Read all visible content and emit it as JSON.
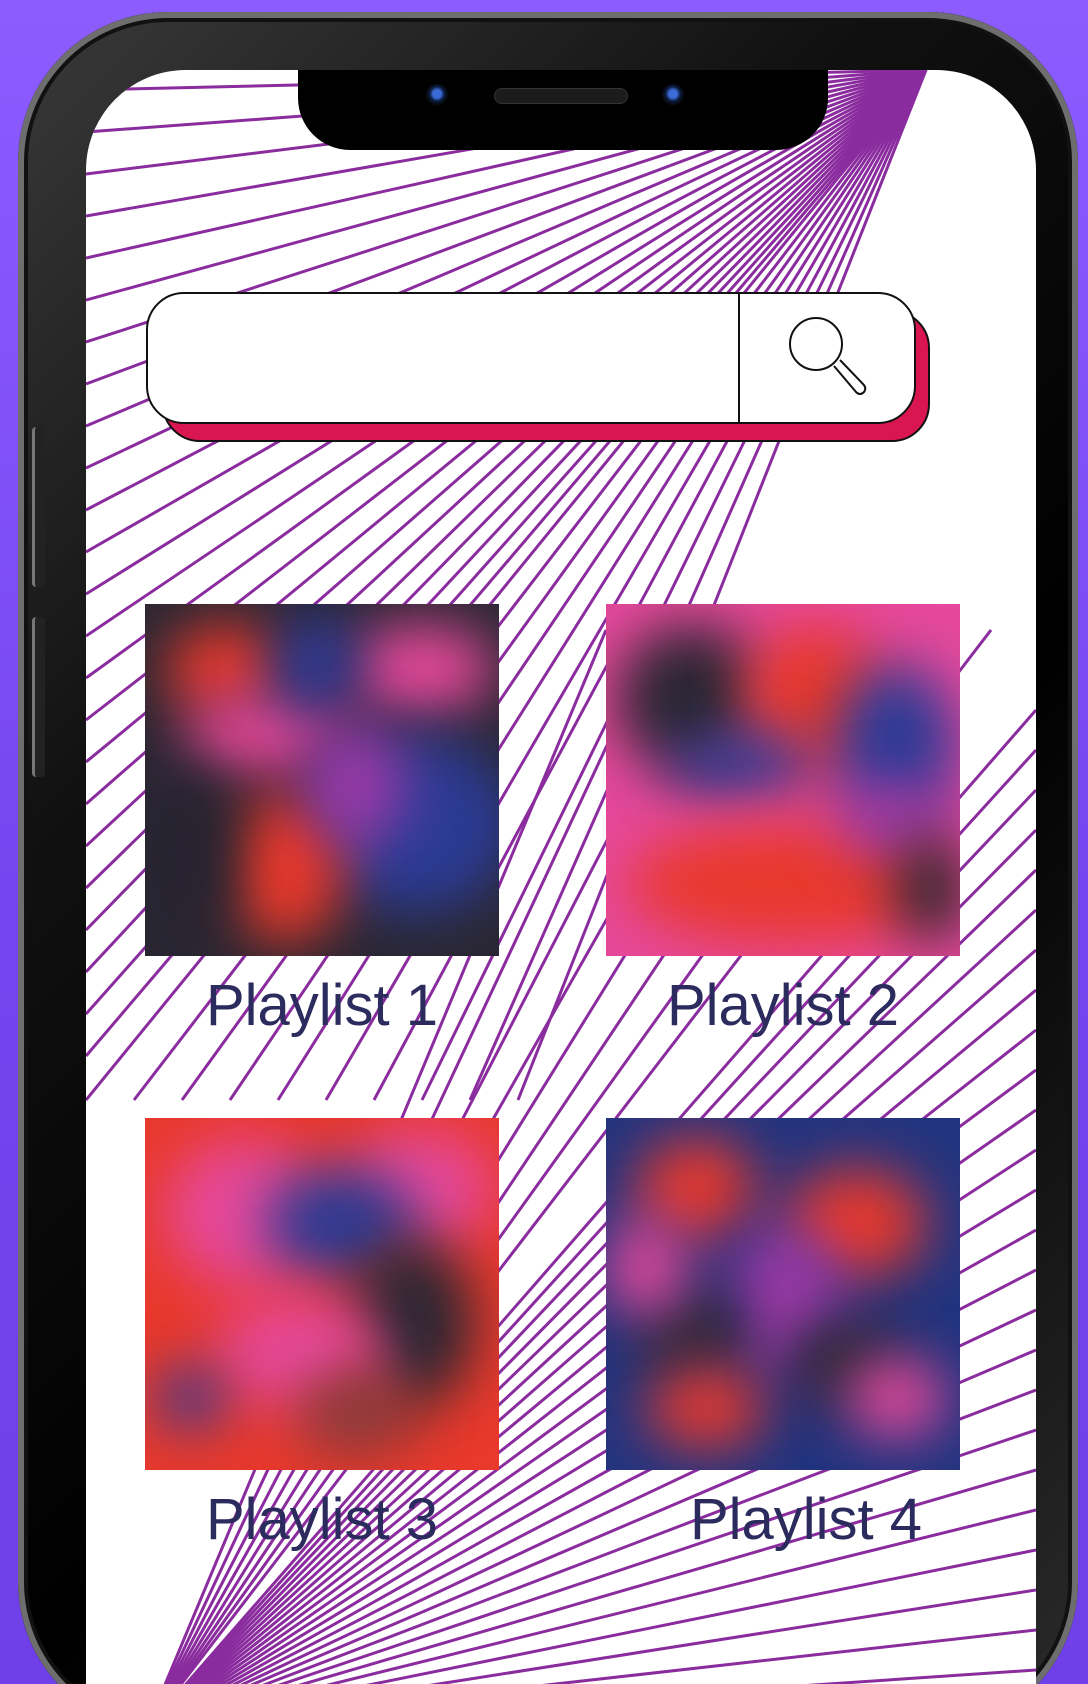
{
  "search": {
    "value": "",
    "placeholder": ""
  },
  "playlists": [
    {
      "label": "Playlist 1"
    },
    {
      "label": "Playlist 2"
    },
    {
      "label": "Playlist 3"
    },
    {
      "label": "Playlist 4"
    }
  ],
  "colors": {
    "background": "#7b4ff5",
    "line_accent": "#8a2c9e",
    "search_shadow": "#d9164f",
    "caption_text": "#2b2b5e"
  },
  "icons": {
    "search": "magnifier-icon"
  }
}
